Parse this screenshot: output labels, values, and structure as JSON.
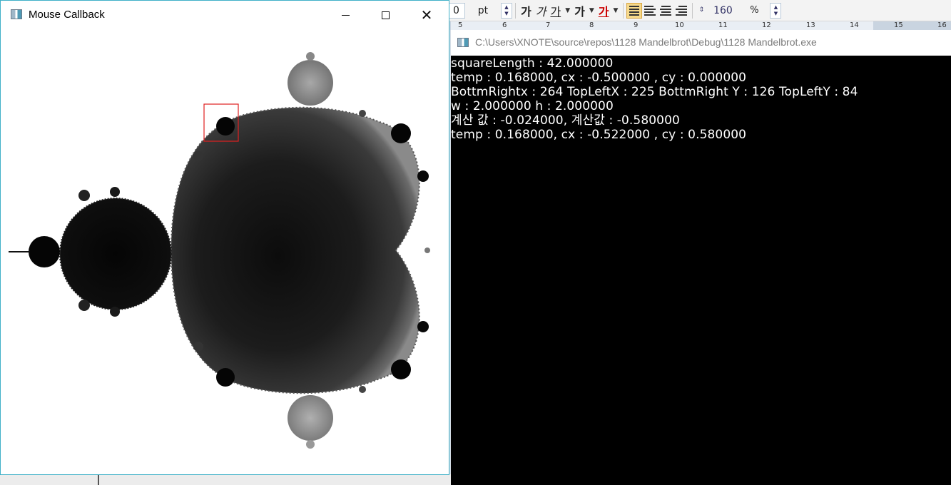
{
  "background_app": {
    "toolbar": {
      "size_value": "0",
      "size_unit": "pt",
      "format_glyphs": [
        "가",
        "가",
        "가",
        "가",
        "가"
      ],
      "zoom_value": "160",
      "zoom_unit": "%",
      "line_spacing_icon": "line-spacing-icon"
    },
    "ruler_numbers": [
      "5",
      "6",
      "7",
      "8",
      "9",
      "10",
      "11",
      "12",
      "13",
      "14",
      "15",
      "16"
    ]
  },
  "mouse_window": {
    "title": "Mouse Callback",
    "icon": "app-window-icon",
    "controls": {
      "minimize": "minimize-icon",
      "maximize": "maximize-icon",
      "close": "close-icon"
    },
    "selection_box_color": "#e02020"
  },
  "console_window": {
    "title": "C:\\Users\\XNOTE\\source\\repos\\1128 Mandelbrot\\Debug\\1128 Mandelbrot.exe",
    "lines": [
      "squareLength : 42.000000",
      "temp : 0.168000, cx : -0.500000 , cy : 0.000000",
      "BottmRightx : 264 TopLeftX : 225 BottmRight Y : 126 TopLeftY : 84",
      "w : 2.000000 h : 2.000000",
      "계산 값 : -0.024000, 계산값 : -0.580000",
      "temp : 0.168000, cx : -0.522000 , cy : 0.580000"
    ]
  },
  "colors": {
    "window_border": "#3fb0c8",
    "console_bg": "#000000",
    "console_text": "#ffffff"
  }
}
